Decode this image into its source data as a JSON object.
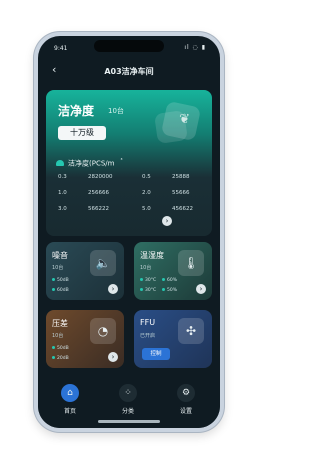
{
  "status": {
    "time": "9:41",
    "indicators": "ıl ◌ ▮"
  },
  "header": {
    "back_icon": "chevron-left-icon",
    "title": "A03洁净车间"
  },
  "cleanliness": {
    "title": "洁净度",
    "count": "10台",
    "level_badge": "十万级",
    "subtitle": "洁净度(PCS/m",
    "subtitle_superscript": "³",
    "table": [
      [
        "0.3",
        "2820000",
        "0.5",
        "25888"
      ],
      [
        "1.0",
        "256666",
        "2.0",
        "55666"
      ],
      [
        "3.0",
        "566222",
        "5.0",
        "456622"
      ]
    ]
  },
  "tiles": {
    "noise": {
      "title": "噪音",
      "count": "10台",
      "l1": "50dB",
      "l2": "60dB"
    },
    "humidity": {
      "title": "温湿度",
      "count": "10台",
      "l1": "30°C",
      "l2": "30°C",
      "l3": "60%",
      "l4": "50%"
    },
    "pressure": {
      "title": "压差",
      "count": "10台",
      "l1": "50dB",
      "l2": "20dB"
    },
    "ffu": {
      "title": "FFU",
      "count": "已开启",
      "control": "控制"
    }
  },
  "tabbar": {
    "home": "首页",
    "category": "分类",
    "settings": "设置"
  }
}
